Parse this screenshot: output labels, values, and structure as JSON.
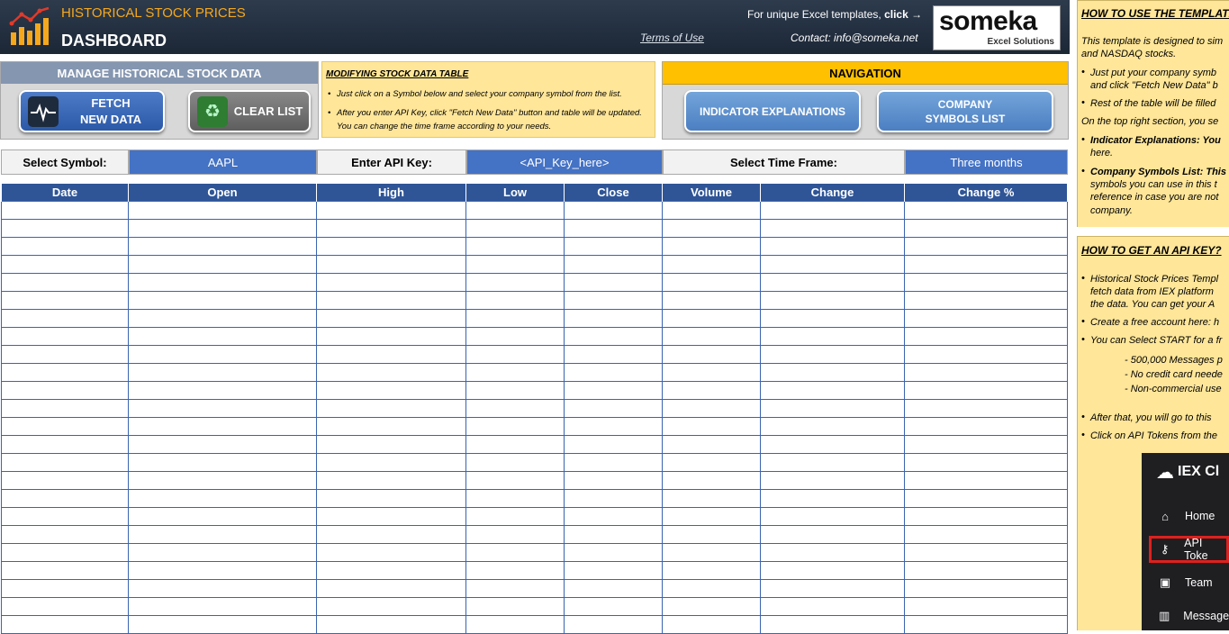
{
  "header": {
    "title": "HISTORICAL STOCK PRICES",
    "subtitle": "DASHBOARD",
    "terms_link": "Terms of Use",
    "unique_text": "For unique Excel templates,",
    "unique_click": "click →",
    "contact": "Contact: info@someka.net",
    "brand_name": "someka",
    "brand_sub": "Excel Solutions"
  },
  "manage": {
    "title": "MANAGE HISTORICAL STOCK DATA",
    "fetch_line1": "FETCH",
    "fetch_line2": "NEW DATA",
    "clear_label": "CLEAR LIST"
  },
  "info": {
    "title": "MODIFYING STOCK DATA TABLE",
    "line1": "Just click on a Symbol below and select your company symbol from the list.",
    "line2": "After you enter API Key, click \"Fetch New Data\" button and table will be updated.",
    "line3": "You can change the time frame according to your needs."
  },
  "navigation": {
    "title": "NAVIGATION",
    "indicator_button": "INDICATOR EXPLANATIONS",
    "symbols_line1": "COMPANY",
    "symbols_line2": "SYMBOLS LIST"
  },
  "inputs": {
    "symbol_label": "Select Symbol:",
    "symbol_value": "AAPL",
    "api_label": "Enter API Key:",
    "api_value": "<API_Key_here>",
    "timeframe_label": "Select Time Frame:",
    "timeframe_value": "Three months"
  },
  "table": {
    "columns": [
      "Date",
      "Open",
      "High",
      "Low",
      "Close",
      "Volume",
      "Change",
      "Change %"
    ]
  },
  "sidebar": {
    "how_to_use_title": "HOW TO USE THE TEMPLATE",
    "how_lines": [
      "This template is designed to sim",
      "and NASDAQ stocks.",
      "Just put your company symb",
      "and click \"Fetch New Data\" b",
      "Rest of the table will be filled",
      "On the top right section, you se",
      "Indicator Explanations: You",
      "here.",
      "Company Symbols List: This",
      "symbols you can use in this t",
      "reference in case you are not",
      "company."
    ],
    "api_title": "HOW TO GET AN API KEY?",
    "api_lines": [
      "Historical Stock Prices Templ",
      "fetch data from IEX platform",
      "the data. You can get your A",
      "Create a free account here: h",
      "You can Select START for a fr",
      "- 500,000 Messages p",
      "- No credit card neede",
      "- Non-commercial use",
      "After that, you will go to this",
      "Click on API Tokens from the"
    ],
    "iex": {
      "brand": "IEX Cl",
      "items": [
        "Home",
        "API Toke",
        "Team",
        "Message"
      ]
    }
  }
}
